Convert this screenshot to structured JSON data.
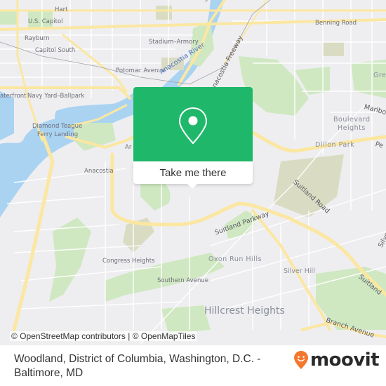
{
  "map": {
    "labels": {
      "hart": "Hart",
      "us_capitol": "U.S. Capitol",
      "rayburn": "Rayburn",
      "capitol_south": "Capitol South",
      "stadium_armory": "Stadium–Armory",
      "potomac_avenue": "Potomac Avenue",
      "waterfront": "aterfront",
      "navy_yard": "Navy Yard–Ballpark",
      "heritage_island": "Heritage Island",
      "benning_road": "Benning Road",
      "anacostia_river": "Anacostia River",
      "anacostia_freeway": "Anacostia Freeway",
      "diamond_teague_1": "Diamond Teague",
      "diamond_teague_2": "Ferry Landing",
      "anacostia": "Anacostia",
      "anacostia_partial": "Ar",
      "greenway": "Gre",
      "marlboro": "Marlbo",
      "boulevard_heights_1": "Boulevard",
      "boulevard_heights_2": "Heights",
      "dillon_park": "Dillon Park",
      "pennsylvania": "Pe",
      "suitland_road": "Suitland Road",
      "suitland_parkway": "Suitland Parkway",
      "silver": "Silve",
      "oxon_run_hills": "Oxon Run Hills",
      "congress_heights": "Congress Heights",
      "southern_avenue": "Southern Avenue",
      "silver_hill": "Silver Hill",
      "suitland": "Suitland",
      "hillcrest_heights": "Hillcrest Heights",
      "branch_avenue": "Branch Avenue"
    },
    "attribution": "© OpenStreetMap contributors | © OpenMapTiles",
    "colors": {
      "background": "#eeeef0",
      "park": "#cfe8c1",
      "water": "#aad3f2",
      "major_road": "#fbe7a1",
      "minor_road": "#ffffff",
      "landuse": "#d9dcc2"
    }
  },
  "popup": {
    "icon": "map-pin-icon",
    "button_label": "Take me there",
    "color": "#1fb86a"
  },
  "footer": {
    "location_title": "Woodland, District of Columbia, Washington, D.C. - Baltimore, MD",
    "brand": "moovit",
    "brand_icon": "moovit-pin-smiley-icon",
    "brand_color": "#f4772d"
  }
}
